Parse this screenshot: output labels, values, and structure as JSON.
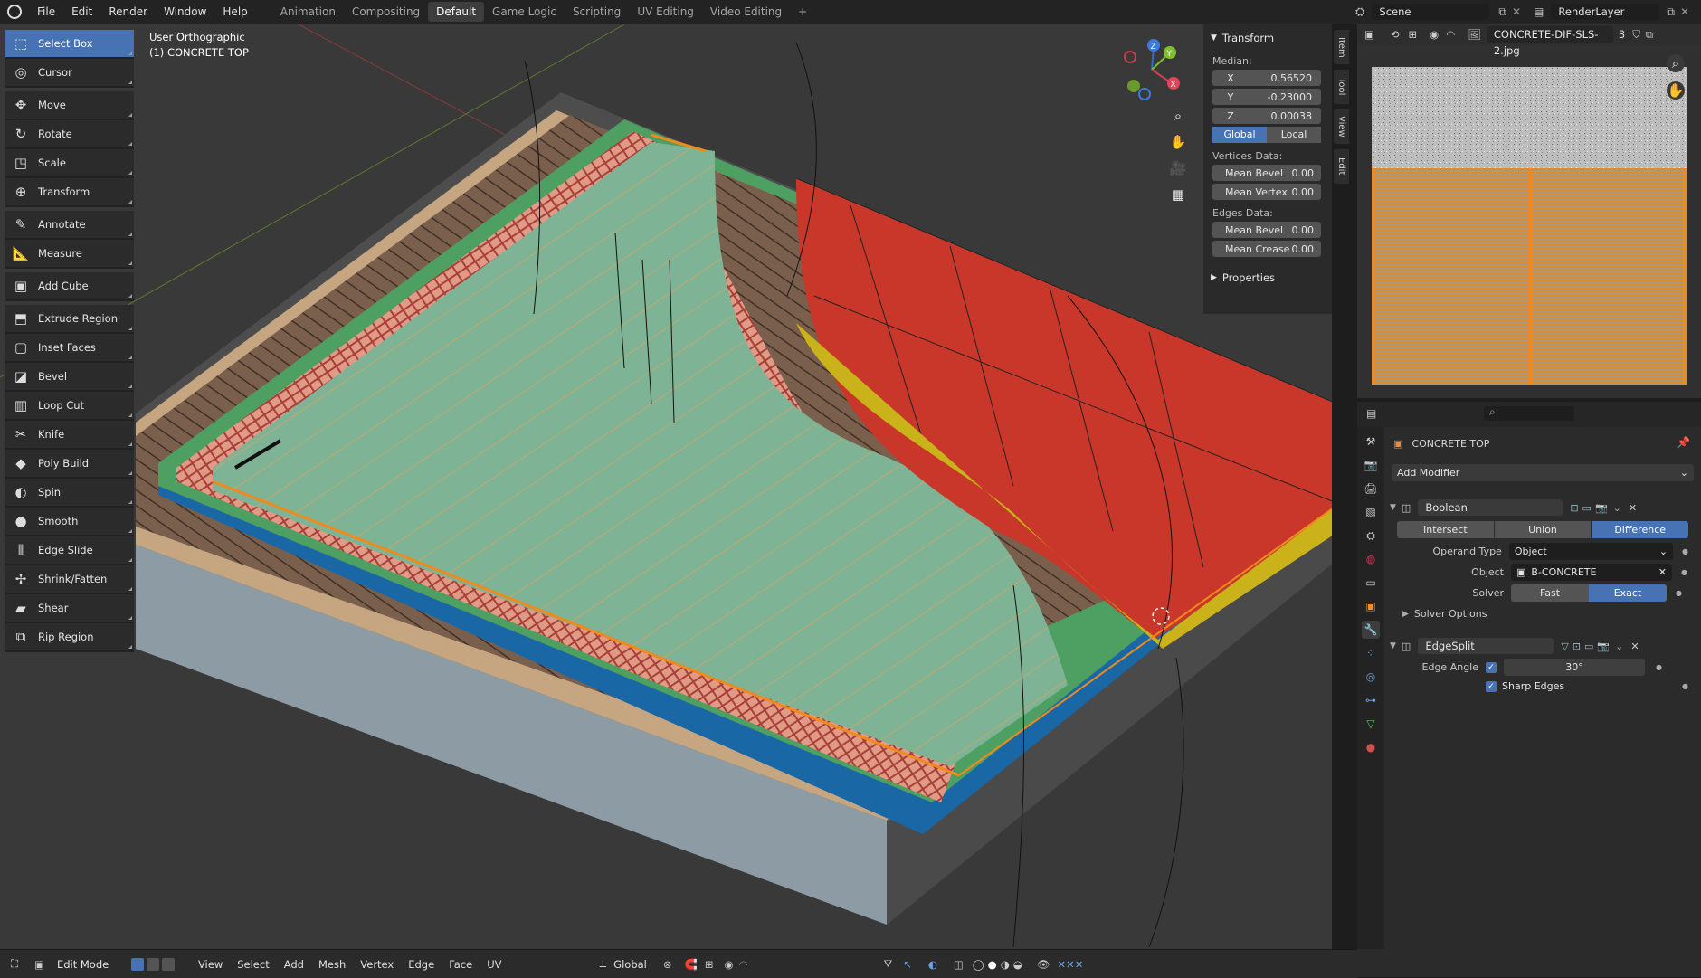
{
  "menus": [
    "File",
    "Edit",
    "Render",
    "Window",
    "Help"
  ],
  "workspaces": [
    {
      "label": "Animation",
      "active": false
    },
    {
      "label": "Compositing",
      "active": false
    },
    {
      "label": "Default",
      "active": true
    },
    {
      "label": "Game Logic",
      "active": false
    },
    {
      "label": "Scripting",
      "active": false
    },
    {
      "label": "UV Editing",
      "active": false
    },
    {
      "label": "Video Editing",
      "active": false
    }
  ],
  "add_workspace": "+",
  "scene": {
    "name": "Scene",
    "render_layer": "RenderLayer"
  },
  "viewport": {
    "view_name": "User Orthographic",
    "object_name": "(1) CONCRETE TOP"
  },
  "gizmo": {
    "x": "X",
    "y": "Y",
    "z": "Z"
  },
  "toolbar": [
    {
      "label": "Select Box",
      "icon": "select-box-icon",
      "glyph": "⬚",
      "active": true,
      "gap": false
    },
    {
      "label": "Cursor",
      "icon": "cursor-icon",
      "glyph": "◎",
      "active": false,
      "gap": false
    },
    {
      "label": "Move",
      "icon": "move-icon",
      "glyph": "✥",
      "active": false,
      "gap": true
    },
    {
      "label": "Rotate",
      "icon": "rotate-icon",
      "glyph": "↻",
      "active": false,
      "gap": false
    },
    {
      "label": "Scale",
      "icon": "scale-icon",
      "glyph": "◳",
      "active": false,
      "gap": false
    },
    {
      "label": "Transform",
      "icon": "transform-icon",
      "glyph": "⊕",
      "active": false,
      "gap": false
    },
    {
      "label": "Annotate",
      "icon": "annotate-icon",
      "glyph": "✎",
      "active": false,
      "gap": true
    },
    {
      "label": "Measure",
      "icon": "measure-icon",
      "glyph": "📐",
      "active": false,
      "gap": false
    },
    {
      "label": "Add Cube",
      "icon": "add-cube-icon",
      "glyph": "▣",
      "active": false,
      "gap": true
    },
    {
      "label": "Extrude Region",
      "icon": "extrude-region-icon",
      "glyph": "⬒",
      "active": false,
      "gap": true
    },
    {
      "label": "Inset Faces",
      "icon": "inset-faces-icon",
      "glyph": "▢",
      "active": false,
      "gap": false
    },
    {
      "label": "Bevel",
      "icon": "bevel-icon",
      "glyph": "◪",
      "active": false,
      "gap": false
    },
    {
      "label": "Loop Cut",
      "icon": "loop-cut-icon",
      "glyph": "▥",
      "active": false,
      "gap": false
    },
    {
      "label": "Knife",
      "icon": "knife-icon",
      "glyph": "✂",
      "active": false,
      "gap": false
    },
    {
      "label": "Poly Build",
      "icon": "poly-build-icon",
      "glyph": "◆",
      "active": false,
      "gap": false
    },
    {
      "label": "Spin",
      "icon": "spin-icon",
      "glyph": "◐",
      "active": false,
      "gap": false
    },
    {
      "label": "Smooth",
      "icon": "smooth-icon",
      "glyph": "●",
      "active": false,
      "gap": false
    },
    {
      "label": "Edge Slide",
      "icon": "edge-slide-icon",
      "glyph": "⫴",
      "active": false,
      "gap": false
    },
    {
      "label": "Shrink/Fatten",
      "icon": "shrink-fatten-icon",
      "glyph": "✢",
      "active": false,
      "gap": false
    },
    {
      "label": "Shear",
      "icon": "shear-icon",
      "glyph": "▰",
      "active": false,
      "gap": false
    },
    {
      "label": "Rip Region",
      "icon": "rip-region-icon",
      "glyph": "⧉",
      "active": false,
      "gap": false
    }
  ],
  "npanel": {
    "section_transform": "Transform",
    "median_label": "Median:",
    "x_label": "X",
    "x": "0.56520",
    "y_label": "Y",
    "y": "-0.23000",
    "z_label": "Z",
    "z": "0.00038",
    "global": "Global",
    "local": "Local",
    "vertices_data": "Vertices Data:",
    "mean_bevel_v_label": "Mean Bevel",
    "mean_bevel_v": "0.00",
    "mean_vertex_label": "Mean Vertex",
    "mean_vertex": "0.00",
    "edges_data": "Edges Data:",
    "mean_bevel_e_label": "Mean Bevel",
    "mean_bevel_e": "0.00",
    "mean_crease_label": "Mean Crease",
    "mean_crease": "0.00",
    "section_properties": "Properties"
  },
  "side_tabs": [
    "Item",
    "Tool",
    "View",
    "Edit"
  ],
  "image_editor": {
    "image_name": "CONCRETE-DIF-SLS-2.jpg",
    "users": "3"
  },
  "properties": {
    "object_name": "CONCRETE TOP",
    "add_modifier": "Add Modifier",
    "boolean": {
      "name": "Boolean",
      "ops": [
        {
          "label": "Intersect",
          "on": false
        },
        {
          "label": "Union",
          "on": false
        },
        {
          "label": "Difference",
          "on": true
        }
      ],
      "operand_type_label": "Operand Type",
      "operand_type": "Object",
      "object_label": "Object",
      "object": "B-CONCRETE",
      "solver_label": "Solver",
      "solver_fast": "Fast",
      "solver_exact": "Exact",
      "solver_options": "Solver Options"
    },
    "edgesplit": {
      "name": "EdgeSplit",
      "edge_angle_label": "Edge Angle",
      "edge_angle": "30°",
      "sharp_edges": "Sharp Edges"
    }
  },
  "bottombar": {
    "mode": "Edit Mode",
    "menus": [
      "View",
      "Select",
      "Add",
      "Mesh",
      "Vertex",
      "Edge",
      "Face",
      "UV"
    ],
    "orientation": "Global"
  },
  "colors": {
    "accent": "#4772b3",
    "red_roof": "#c8372a",
    "green_floor": "#76ad88",
    "orange_sel": "#f08a1c"
  }
}
